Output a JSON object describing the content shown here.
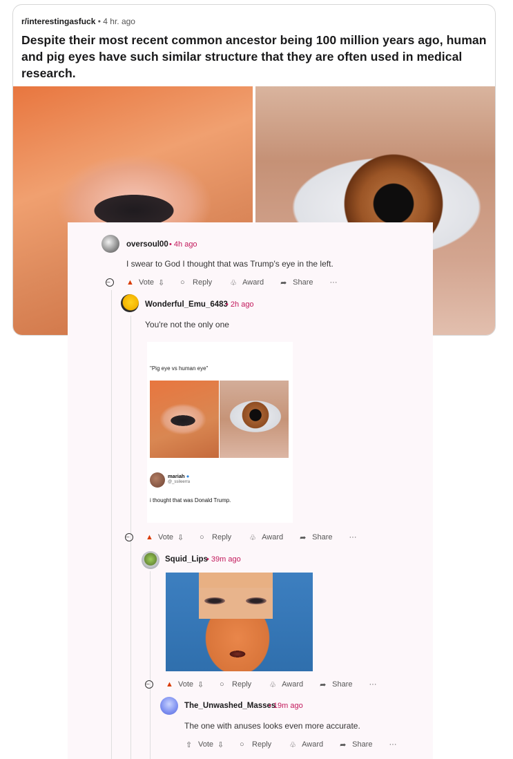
{
  "post": {
    "subreddit": "r/interestingasfuck",
    "separator": "•",
    "age": "4 hr. ago",
    "title": "Despite their most recent common ancestor being 100 million years ago, human and pig eyes have such similar structure that they are often used in medical research."
  },
  "actions": {
    "vote": "Vote",
    "reply": "Reply",
    "award": "Award",
    "share": "Share",
    "more": "···"
  },
  "comments": [
    {
      "user": "oversoul00",
      "time": "• 4h ago",
      "text": "I swear to God I thought that was Trump's eye in the left."
    },
    {
      "user": "Wonderful_Emu_6483",
      "time": "• 2h ago",
      "text": "You're not the only one"
    },
    {
      "user": "Squid_Lips",
      "time": "• 39m ago",
      "text": ""
    },
    {
      "user": "The_Unwashed_Masses",
      "time": "• 19m ago",
      "text": "The one with anuses looks even more accurate."
    }
  ],
  "tweet": {
    "caption": "\"Pig eye vs human eye\"",
    "name": "mariah",
    "handle": "@_ssileerra",
    "text": "i thought that was Donald Trump."
  },
  "colors": {
    "upvote": "#d93a00",
    "time": "#c2185b",
    "comment_bg": "#fdf7fa"
  }
}
